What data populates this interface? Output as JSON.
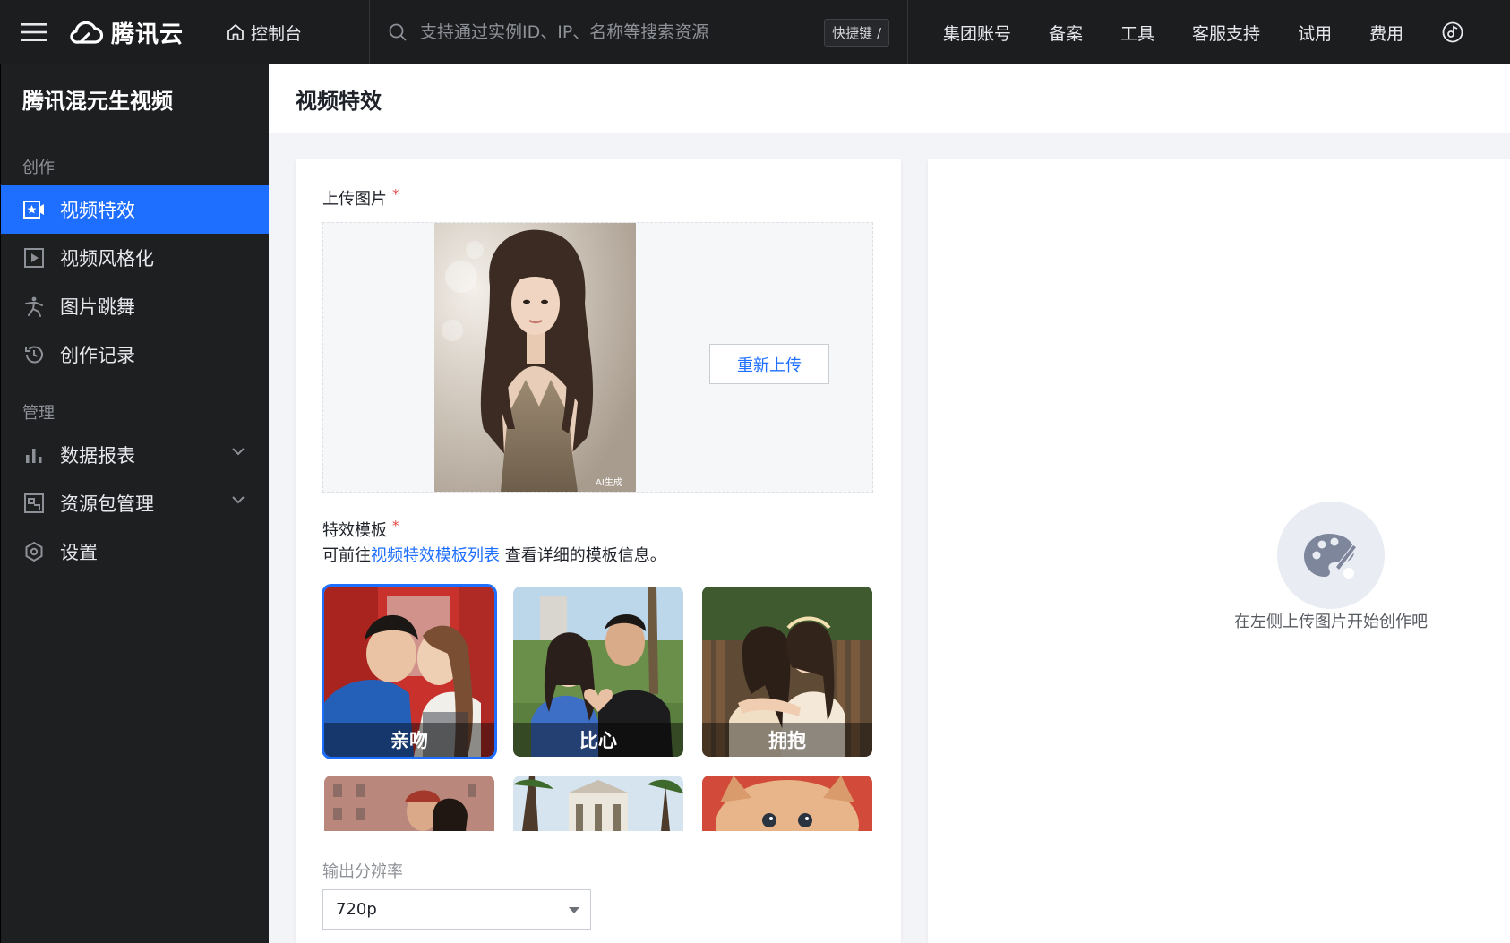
{
  "topbar": {
    "brand": "腾讯云",
    "console": "控制台",
    "search_placeholder": "支持通过实例ID、IP、名称等搜索资源",
    "shortcut": "快捷键 /",
    "links": [
      "集团账号",
      "备案",
      "工具",
      "客服支持",
      "试用",
      "费用"
    ]
  },
  "sidebar": {
    "title": "腾讯混元生视频",
    "groups": [
      {
        "label": "创作",
        "items": [
          {
            "label": "视频特效",
            "icon": "video-star-icon",
            "active": true
          },
          {
            "label": "视频风格化",
            "icon": "play-square-icon"
          },
          {
            "label": "图片跳舞",
            "icon": "dance-icon"
          },
          {
            "label": "创作记录",
            "icon": "history-icon"
          }
        ]
      },
      {
        "label": "管理",
        "items": [
          {
            "label": "数据报表",
            "icon": "bar-chart-icon",
            "expandable": true
          },
          {
            "label": "资源包管理",
            "icon": "package-icon",
            "expandable": true
          },
          {
            "label": "设置",
            "icon": "settings-icon"
          }
        ]
      }
    ]
  },
  "page": {
    "title": "视频特效"
  },
  "form": {
    "upload_label": "上传图片",
    "required_mark": "*",
    "reupload": "重新上传",
    "watermark": "AI生成",
    "template_label": "特效模板",
    "template_hint_prefix": "可前往",
    "template_hint_link": "视频特效模板列表",
    "template_hint_suffix": " 查看详细的模板信息。",
    "templates": [
      {
        "label": "亲吻",
        "selected": true
      },
      {
        "label": "比心"
      },
      {
        "label": "拥抱"
      }
    ],
    "resolution_label": "输出分辨率",
    "resolution_value": "720p"
  },
  "result": {
    "empty_text": "在左侧上传图片开始创作吧"
  },
  "colors": {
    "accent": "#1e6fff",
    "topbar_bg": "#1c1d1f",
    "sidebar_bg": "#1e1f21",
    "required": "#e54545"
  }
}
